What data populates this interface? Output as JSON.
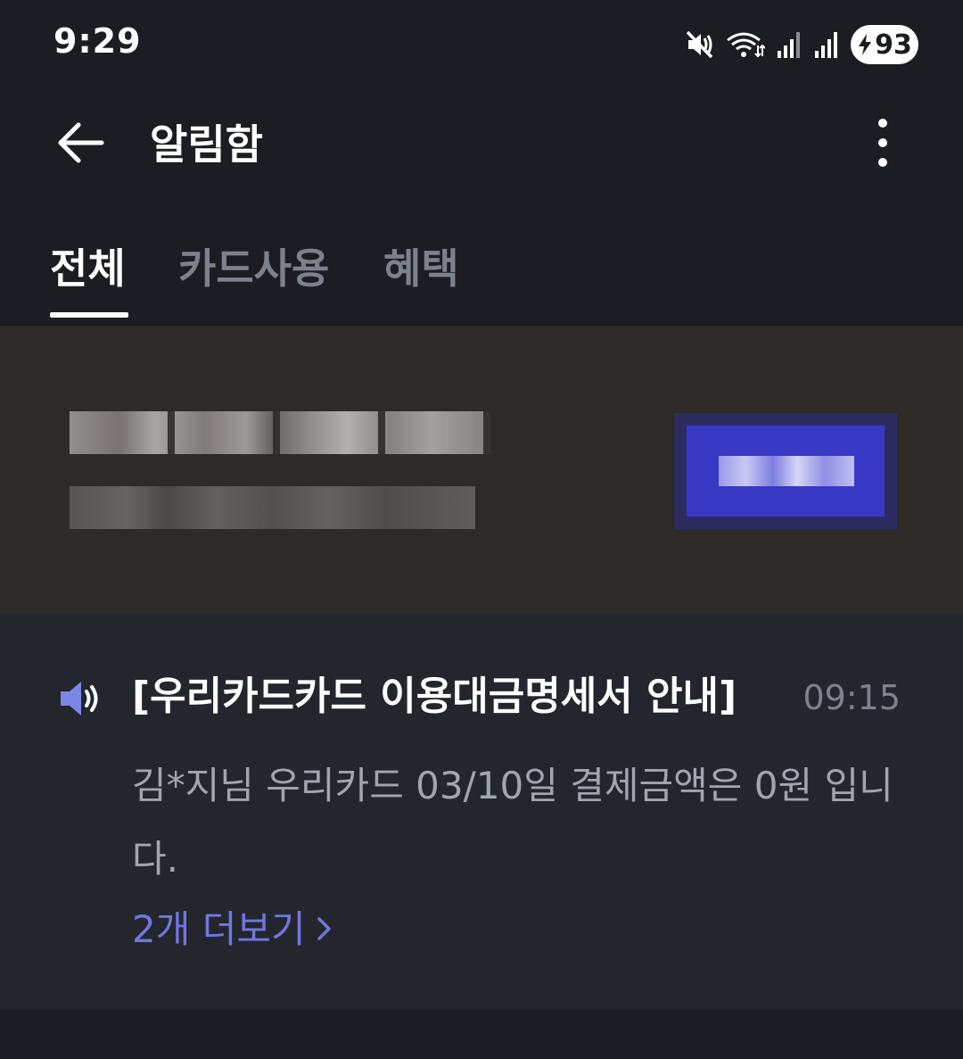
{
  "status_bar": {
    "time": "9:29",
    "battery": "93",
    "icons": [
      "mute-icon",
      "wifi-icon",
      "signal-icon",
      "signal-icon",
      "battery-charging-icon"
    ]
  },
  "header": {
    "title": "알림함",
    "back_icon": "arrow-left-icon",
    "more_icon": "more-vertical-icon"
  },
  "tabs": [
    {
      "label": "전체",
      "active": true
    },
    {
      "label": "카드사용",
      "active": false
    },
    {
      "label": "혜택",
      "active": false
    }
  ],
  "notifications": [
    {
      "icon": "speaker-icon",
      "title": "[우리카드카드 이용대금명세서 안내]",
      "time": "09:15",
      "body": "김*지님 우리카드 03/10일 결제금액은 0원 입니다.",
      "more_label": "2개 더보기"
    }
  ],
  "colors": {
    "background": "#1b1d22",
    "card_background": "#23262d",
    "banner_background": "#2d2a27",
    "accent": "#7176e0",
    "tab_inactive": "#7c818c"
  }
}
